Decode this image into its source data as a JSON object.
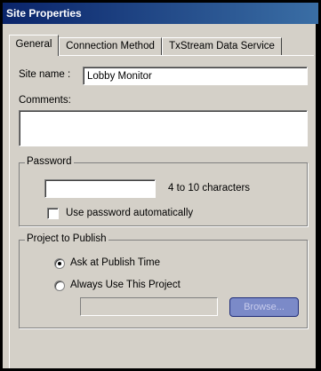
{
  "window": {
    "title": "Site Properties"
  },
  "tabs": [
    {
      "label": "General",
      "active": true
    },
    {
      "label": "Connection Method",
      "active": false
    },
    {
      "label": "TxStream Data Service",
      "active": false
    }
  ],
  "general": {
    "site_name_label": "Site name :",
    "site_name_value": "Lobby Monitor",
    "comments_label": "Comments:",
    "comments_value": ""
  },
  "password": {
    "group_title": "Password",
    "value": "",
    "hint": "4 to 10 characters",
    "auto_label": "Use password automatically",
    "auto_checked": false
  },
  "project": {
    "group_title": "Project to Publish",
    "options": [
      {
        "label": "Ask at Publish Time",
        "selected": true
      },
      {
        "label": "Always Use This Project",
        "selected": false
      }
    ],
    "path_value": "",
    "browse_label": "Browse..."
  }
}
